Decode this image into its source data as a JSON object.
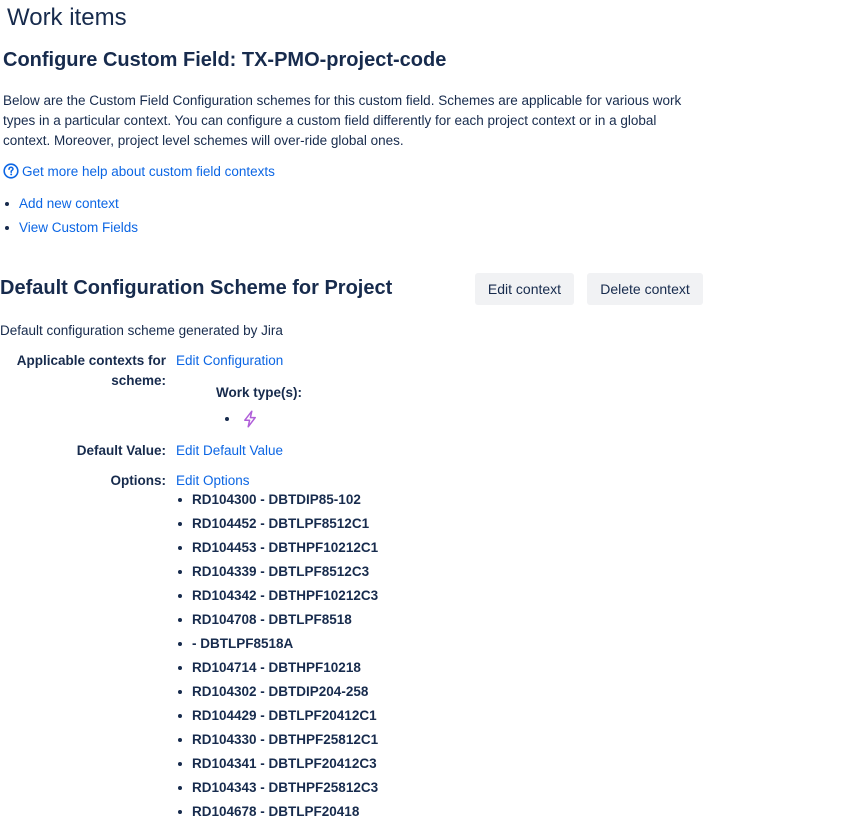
{
  "page": {
    "title": "Work items"
  },
  "field": {
    "heading": "Configure Custom Field: TX-PMO-project-code",
    "description": "Below are the Custom Field Configuration schemes for this custom field. Schemes are applicable for various work types in a particular context. You can configure a custom field differently for each project context or in a global context. Moreover, project level schemes will over-ride global ones.",
    "help_link": "Get more help about custom field contexts",
    "help_icon": "help-circle-icon"
  },
  "actions": {
    "add_context": "Add new context",
    "view_fields": "View Custom Fields"
  },
  "scheme": {
    "title": "Default Configuration Scheme for Project",
    "edit_context": "Edit context",
    "delete_context": "Delete context",
    "description": "Default configuration scheme generated by Jira",
    "contexts_label": "Applicable contexts for scheme:",
    "edit_configuration": "Edit Configuration",
    "work_types_label": "Work type(s):",
    "work_type_icon": "lightning-bolt-icon",
    "default_value_label": "Default Value:",
    "edit_default_value": "Edit Default Value",
    "options_label": "Options:",
    "edit_options": "Edit Options",
    "options": [
      "RD104300 - DBTDIP85-102",
      "RD104452 - DBTLPF8512C1",
      "RD104453 - DBTHPF10212C1",
      "RD104339 - DBTLPF8512C3",
      "RD104342 - DBTHPF10212C3",
      "RD104708 - DBTLPF8518",
      "- DBTLPF8518A",
      "RD104714 - DBTHPF10218",
      "RD104302 - DBTDIP204-258",
      "RD104429 - DBTLPF20412C1",
      "RD104330 - DBTHPF25812C1",
      "RD104341 - DBTLPF20412C3",
      "RD104343 - DBTHPF25812C3",
      "RD104678 - DBTLPF20418"
    ]
  },
  "colors": {
    "text": "#172b4d",
    "link": "#0c66e4",
    "button_bg": "#f1f2f4",
    "bolt_icon": "#b05fd9"
  }
}
